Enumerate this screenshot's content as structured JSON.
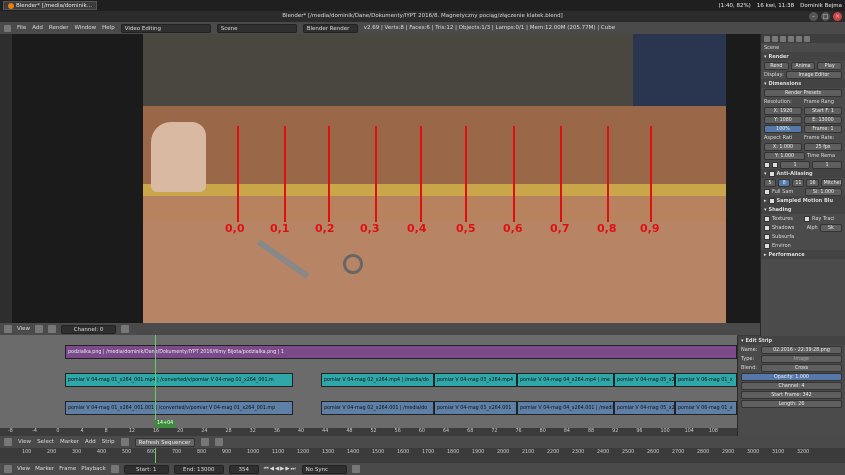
{
  "system": {
    "task_label": "Blender* [/media/dominik...",
    "clock": "16 kwi, 11:38",
    "battery": "(1:40, 82%)",
    "user": "Dominik Bejma"
  },
  "window_title": "Blender* [/media/dominik/Dane/Dokumenty/IYPT 2016/8. Magnetyczny pociąg/złączenie klatek.blend]",
  "menu": [
    "File",
    "Add",
    "Render",
    "Window",
    "Help"
  ],
  "infobar": {
    "layout": "Video Editing",
    "scene": "Scene",
    "engine": "Blender Render",
    "stats": "v2.69 | Verts:8 | Faces:6 | Tris:12 | Objects:1/3 | Lamps:0/1 | Mem:12.00M (205.77M) | Cube"
  },
  "preview": {
    "labels": [
      "0,0",
      "0,1",
      "0,2",
      "0,3",
      "0,4",
      "0,5",
      "0,6",
      "0,7",
      "0,8",
      "0,9"
    ]
  },
  "props": {
    "scene": "Scene",
    "render": "Render",
    "render_btns": [
      "Rend",
      "Anima",
      "Play"
    ],
    "display_label": "Display:",
    "display_value": "Image Editor",
    "dimensions": "Dimensions",
    "presets": "Render Presets",
    "resolution": "Resolution:",
    "frame_range": "Frame Rang",
    "res_x": "X: 1920",
    "res_y": "Y: 1080",
    "res_pct": "100%",
    "start_f": "Start F: 1",
    "end_f": "E: 13000",
    "frame": "Frame: 1",
    "aspect": "Aspect Rati",
    "frame_rate": "Frame Rate:",
    "asp_x": "X: 1.000",
    "asp_y": "Y: 1.000",
    "fps": "25 fps",
    "time_rem": "Time Rema",
    "tr_a": "1",
    "tr_b": "1",
    "anti_alias": "Anti-Aliasing",
    "aa_levels": [
      "5",
      "8",
      "11",
      "16"
    ],
    "aa_filter": "Mitchell-N",
    "full_sample": "Full Sam",
    "size": "Si: 1.000",
    "motion_blur": "Sampled Motion Blu",
    "shading": "Shading",
    "textures": "Textures",
    "ray_trace": "Ray Traci",
    "shadows": "Shadows",
    "alpha": "Alph",
    "alpha_v": "Sk",
    "subsurf": "Subsurfa",
    "environ": "Environ",
    "performance": "Performance"
  },
  "seq_header": {
    "items": [
      "View"
    ],
    "channel": "Channel: 0"
  },
  "strips": {
    "image": "podzialka.png | /media/dominik/Dane/Dokumenty/IYPT 2016/filmy Bijota/podzialka.png | 1",
    "movies": [
      "pomiar V 04-mag 01_x264_001.mp4 | /converted/v/pomiar V 04-mag 01_x264_001.m",
      "pomiar V 04-mag 02_x264.mp4 | /media/do",
      "pomiar V 04-mag 03_x264.mp4",
      "pomiar V 04-mag 04_x264.mp4 | /me",
      "pomiar V 04-mag 05_x2",
      "pomiar V 06-mag 01_x"
    ],
    "audios": [
      "pomiar V 04-mag 01_x264_001.001 | /converted/v/pomiar V 04-mag 01_x264_001.mp",
      "pomiar V 04-mag 02_x264.001 | /media/do",
      "pomiar V 04-mag 03_x264.001",
      "pomiar V 04-mag 04_x264.001 | /media",
      "pomiar V 04-mag 05_x2",
      "pomiar V 06-mag 01_x"
    ],
    "current_frame": "14+04"
  },
  "seq_ruler": [
    "-8",
    "-4",
    "0",
    "4",
    "8",
    "12",
    "16",
    "20",
    "24",
    "28",
    "32",
    "36",
    "40",
    "44",
    "48",
    "52",
    "56",
    "60",
    "64",
    "68",
    "72",
    "76",
    "80",
    "84",
    "88",
    "92",
    "96",
    "100",
    "104",
    "108"
  ],
  "edit_strip": {
    "title": "Edit Strip",
    "name_label": "Name:",
    "name_value": "02.2016 - 22:39:28.png",
    "type_label": "Type:",
    "type_value": "Image",
    "blend_label": "Blend:",
    "blend_value": "Cross",
    "opacity": "Opacity: 1.000",
    "channel": "Channel: 4",
    "start": "Start Frame: 342",
    "length": "Length: 26"
  },
  "bottombar": {
    "items": [
      "View",
      "Select",
      "Marker",
      "Add",
      "Strip"
    ],
    "refresh": "Refresh Sequencer"
  },
  "timeline_ruler": [
    "100",
    "200",
    "300",
    "400",
    "500",
    "600",
    "700",
    "800",
    "900",
    "1000",
    "1100",
    "1200",
    "1300",
    "1400",
    "1500",
    "1600",
    "1700",
    "1800",
    "1900",
    "2000",
    "2100",
    "2200",
    "2300",
    "2400",
    "2500",
    "2600",
    "2700",
    "2800",
    "2900",
    "3000",
    "3100",
    "3200"
  ],
  "timeline_bar": {
    "items": [
      "View",
      "Marker",
      "Frame",
      "Playback"
    ],
    "start": "Start: 1",
    "end": "End: 13000",
    "current": "354",
    "sync": "No Sync"
  }
}
